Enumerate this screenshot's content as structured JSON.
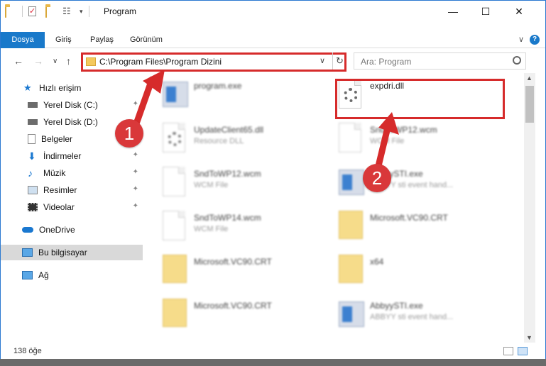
{
  "window": {
    "title": "Program",
    "controls": {
      "minimize": "—",
      "maximize": "☐",
      "close": "✕"
    }
  },
  "ribbon": {
    "tabs": [
      "Dosya",
      "Giriş",
      "Paylaş",
      "Görünüm"
    ],
    "help": "?",
    "collapse": "∨"
  },
  "nav": {
    "back": "←",
    "forward": "→",
    "recent": "∨",
    "up": "↑",
    "address": "C:\\Program Files\\Program Dizini",
    "address_dropdown": "∨",
    "refresh": "↻",
    "search_placeholder": "Ara: Program"
  },
  "sidebar": {
    "items": [
      {
        "label": "Hızlı erişim",
        "icon": "star-icon"
      },
      {
        "label": "Yerel Disk (C:)",
        "icon": "drive-icon",
        "pin": "✦"
      },
      {
        "label": "Yerel Disk (D:)",
        "icon": "drive-icon",
        "pin": "✦"
      },
      {
        "label": "Belgeler",
        "icon": "documents-icon",
        "pin": "✦"
      },
      {
        "label": "İndirmeler",
        "icon": "downloads-icon",
        "pin": "✦"
      },
      {
        "label": "Müzik",
        "icon": "music-icon",
        "pin": "✦"
      },
      {
        "label": "Resimler",
        "icon": "pictures-icon",
        "pin": "✦"
      },
      {
        "label": "Videolar",
        "icon": "videos-icon",
        "pin": "✦"
      },
      {
        "label": "OneDrive",
        "icon": "onedrive-icon"
      },
      {
        "label": "Bu bilgisayar",
        "icon": "computer-icon"
      },
      {
        "label": "Ağ",
        "icon": "network-icon"
      }
    ]
  },
  "files": [
    {
      "name": "program.exe",
      "sub": "",
      "type": "exe"
    },
    {
      "name": "expdri.dll",
      "sub": "",
      "type": "dll"
    },
    {
      "name": "UpdateClient65.dll",
      "sub": "Resource DLL",
      "type": "dll"
    },
    {
      "name": "SndToWP12.wcm",
      "sub": "WCM File",
      "type": "doc"
    },
    {
      "name": "SndToWP12.wcm",
      "sub": "WCM File",
      "type": "doc"
    },
    {
      "name": "AbbyySTI.exe",
      "sub": "ABBYY sti event hand...",
      "type": "exe"
    },
    {
      "name": "SndToWP14.wcm",
      "sub": "WCM File",
      "type": "doc"
    },
    {
      "name": "Microsoft.VC90.CRT",
      "sub": "",
      "type": "folder"
    },
    {
      "name": "Microsoft.VC90.CRT",
      "sub": "",
      "type": "folder"
    },
    {
      "name": "x64",
      "sub": "",
      "type": "folder"
    },
    {
      "name": "Microsoft.VC90.CRT",
      "sub": "",
      "type": "folder"
    },
    {
      "name": "AbbyySTI.exe",
      "sub": "ABBYY sti event hand...",
      "type": "exe"
    }
  ],
  "status": {
    "count": "138 öğe"
  },
  "annotations": {
    "step1": "1",
    "step2": "2",
    "color": "#d62b2b"
  }
}
